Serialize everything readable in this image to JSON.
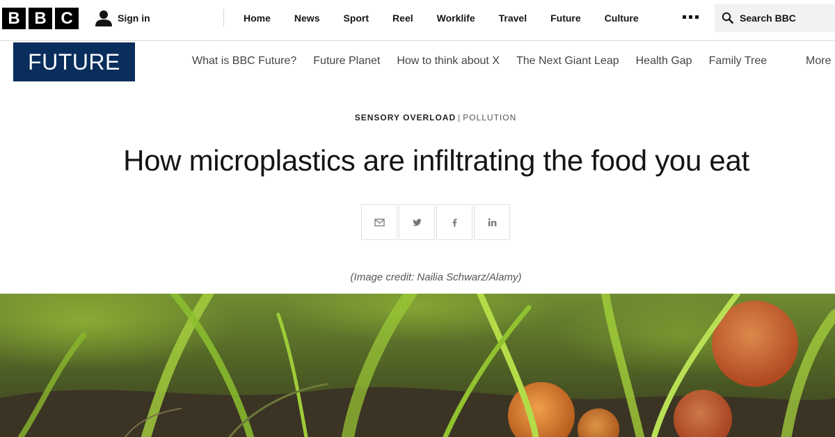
{
  "brand": {
    "letters": [
      "B",
      "B",
      "C"
    ]
  },
  "account": {
    "signin_label": "Sign in",
    "icon": "user-icon"
  },
  "topnav": {
    "items": [
      {
        "label": "Home"
      },
      {
        "label": "News"
      },
      {
        "label": "Sport"
      },
      {
        "label": "Reel"
      },
      {
        "label": "Worklife"
      },
      {
        "label": "Travel"
      },
      {
        "label": "Future"
      },
      {
        "label": "Culture"
      }
    ],
    "more_icon": "more-dots-icon"
  },
  "search": {
    "label": "Search BBC",
    "icon": "search-icon"
  },
  "section": {
    "logo": "FUTURE",
    "logo_color": "#0a2e5c",
    "items": [
      {
        "label": "What is BBC Future?"
      },
      {
        "label": "Future Planet"
      },
      {
        "label": "How to think about X"
      },
      {
        "label": "The Next Giant Leap"
      },
      {
        "label": "Health Gap"
      },
      {
        "label": "Family Tree"
      }
    ],
    "more_label": "More"
  },
  "article": {
    "kicker_section": "SENSORY OVERLOAD",
    "kicker_separator": "|",
    "kicker_topic": "POLLUTION",
    "headline": "How microplastics are infiltrating the food you eat",
    "share": [
      "email-icon",
      "twitter-icon",
      "facebook-icon",
      "linkedin-icon"
    ],
    "image_credit": "(Image credit: Nailia Schwarz/Alamy)"
  }
}
